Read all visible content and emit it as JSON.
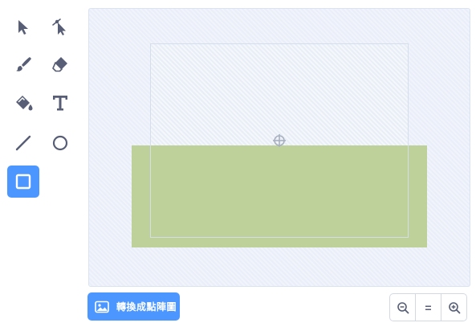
{
  "tools": [
    {
      "name": "select",
      "icon": "select-arrow-icon"
    },
    {
      "name": "reshape",
      "icon": "reshape-arrow-icon"
    },
    {
      "name": "brush",
      "icon": "brush-icon"
    },
    {
      "name": "eraser",
      "icon": "eraser-icon"
    },
    {
      "name": "fill",
      "icon": "fill-bucket-icon"
    },
    {
      "name": "text",
      "icon": "text-icon",
      "glyph": "T"
    },
    {
      "name": "line",
      "icon": "line-icon"
    },
    {
      "name": "circle",
      "icon": "circle-icon"
    },
    {
      "name": "rectangle",
      "icon": "rectangle-icon",
      "active": true
    }
  ],
  "convert_button": {
    "label": "轉換成點陣圖",
    "icon": "image-icon"
  },
  "zoom": {
    "zoom_out_icon": "zoom-out-icon",
    "reset_label": "=",
    "zoom_in_icon": "zoom-in-icon"
  },
  "colors": {
    "accent": "#4c97ff",
    "icon": "#575e75",
    "canvas_bg": "#e9eef8",
    "shape_fill": "#bfd19a"
  }
}
